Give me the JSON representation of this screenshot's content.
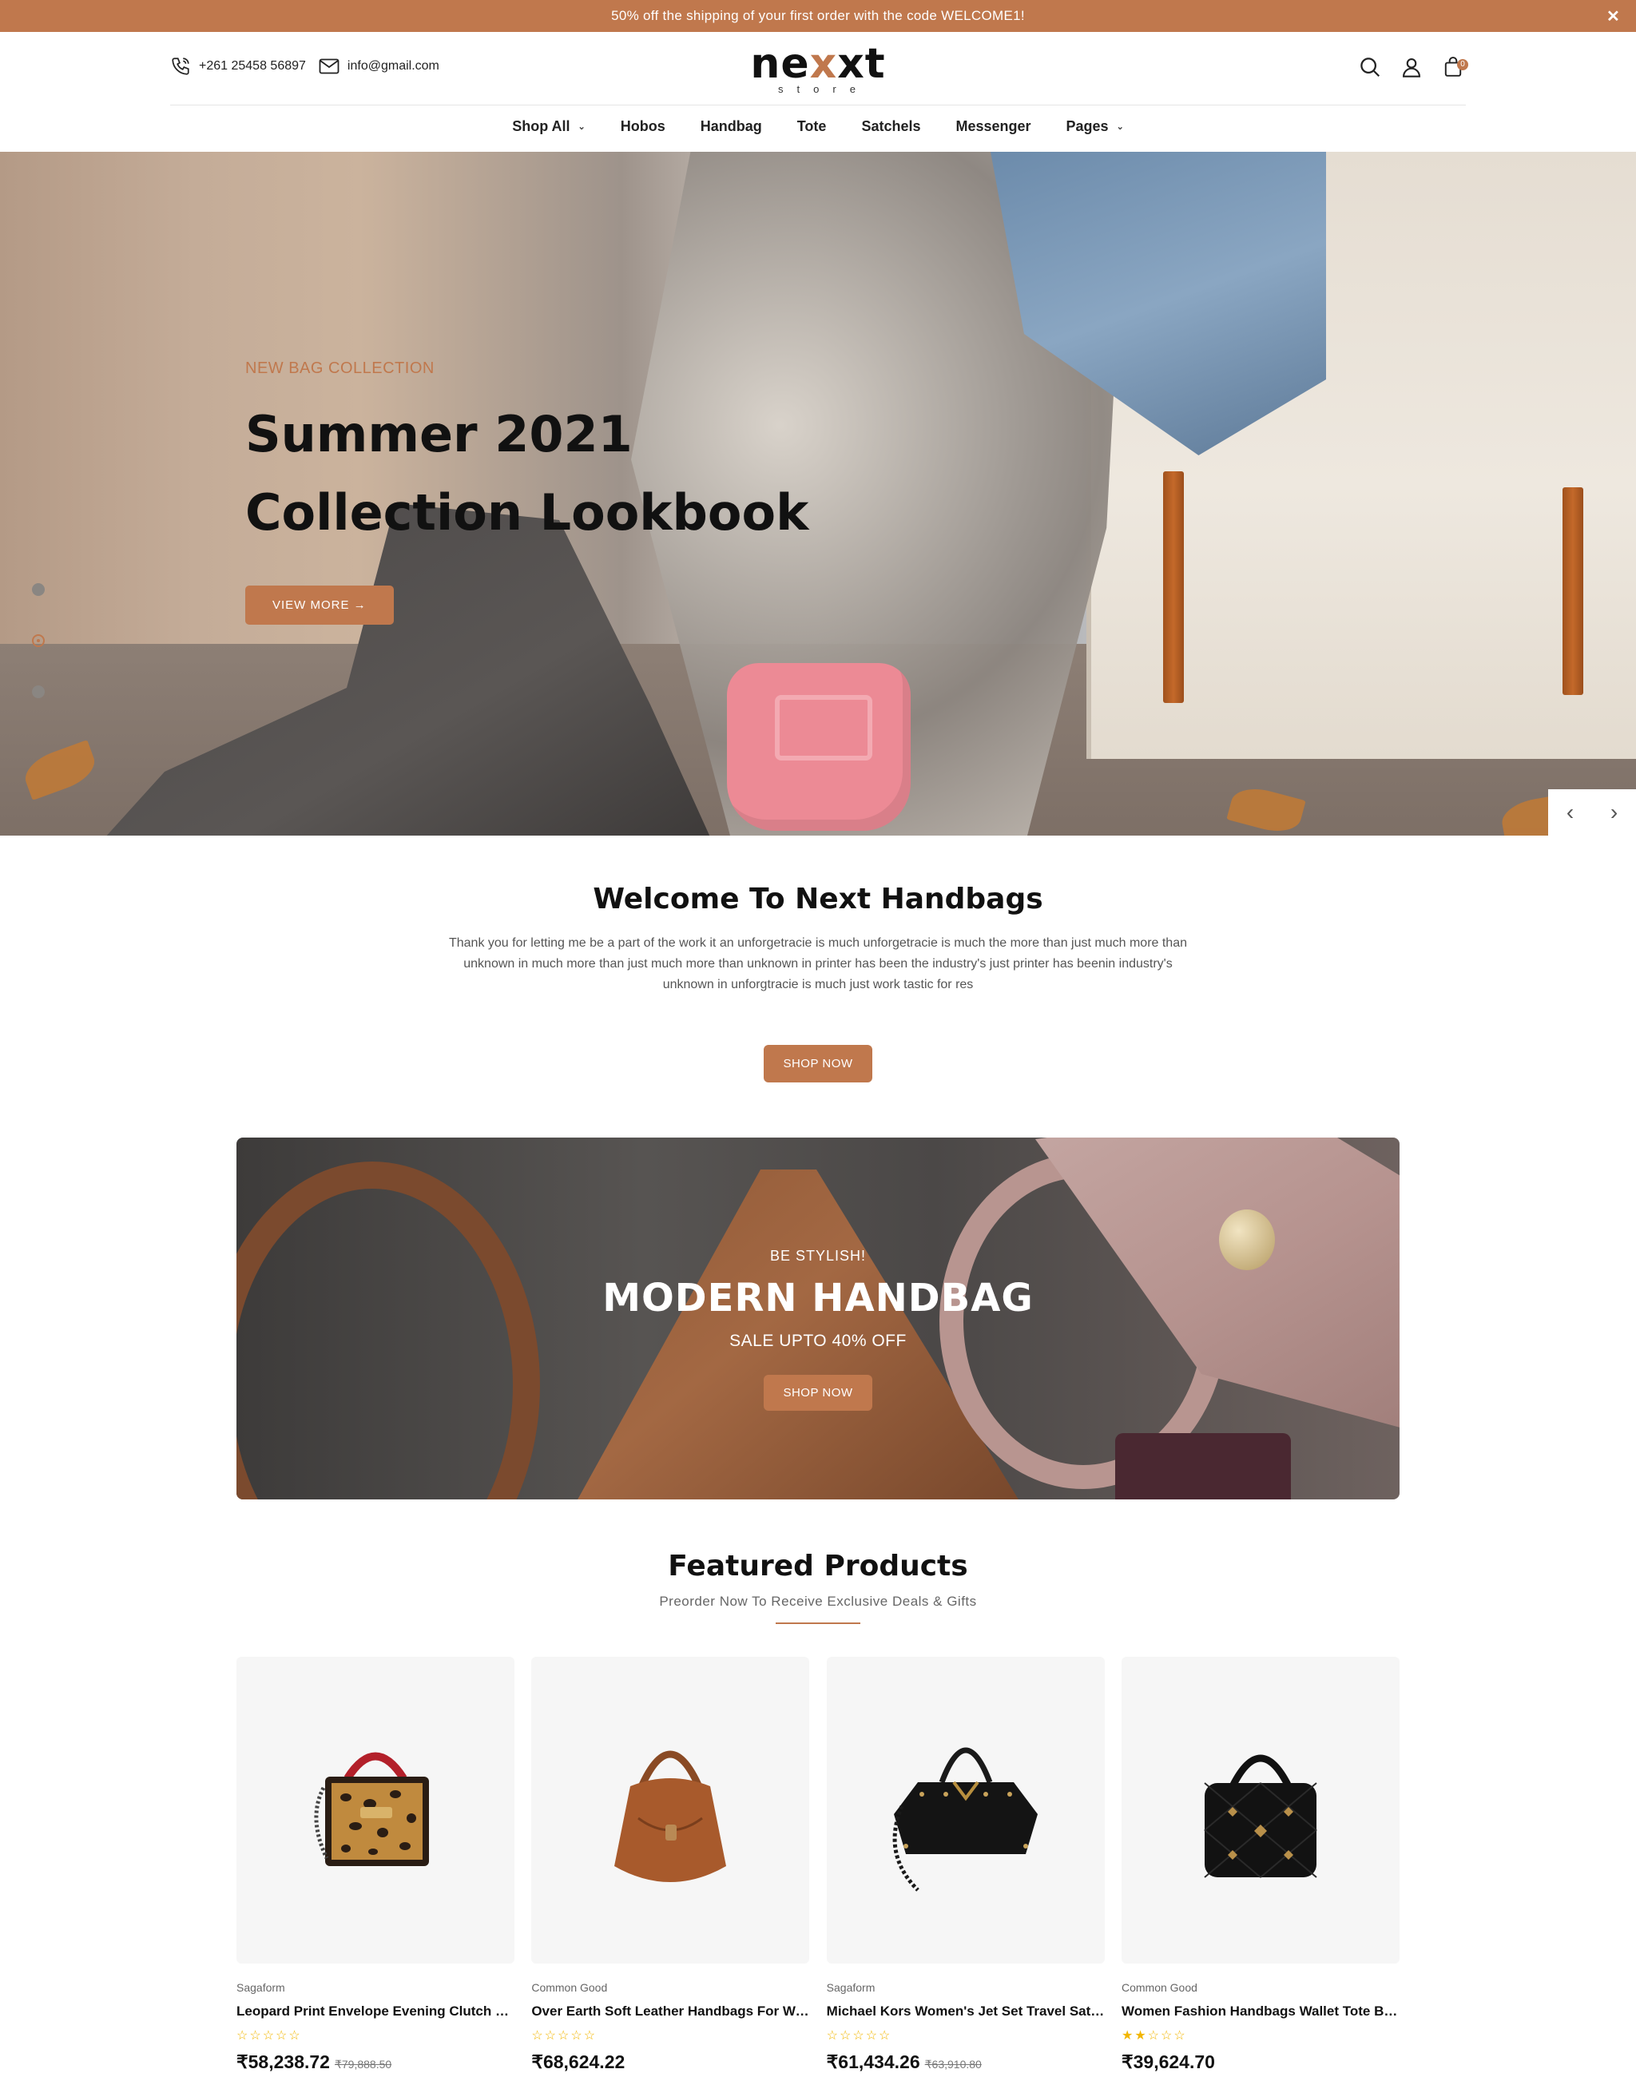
{
  "announcement": {
    "text": "50% off the shipping of your first order with the code WELCOME1!",
    "close": "✕"
  },
  "header": {
    "phone": "+261 25458 56897",
    "email": "info@gmail.com",
    "logo_word_a": "ne",
    "logo_word_x": "x",
    "logo_word_b": "xt",
    "logo_sub": "store",
    "cart_count": "0"
  },
  "nav": {
    "items": [
      {
        "label": "Shop All",
        "dropdown": true
      },
      {
        "label": "Hobos"
      },
      {
        "label": "Handbag"
      },
      {
        "label": "Tote"
      },
      {
        "label": "Satchels"
      },
      {
        "label": "Messenger"
      },
      {
        "label": "Pages",
        "dropdown": true
      }
    ]
  },
  "hero": {
    "kicker": "NEW BAG COLLECTION",
    "title_line1": "Summer 2021",
    "title_line2": "Collection Lookbook",
    "button": "VIEW MORE →"
  },
  "welcome": {
    "title": "Welcome To Next Handbags",
    "body": "Thank you for letting me be a part of the work it an unforgetracie is much unforgetracie is much the more than just much more than unknown in much more than just much more than unknown in printer has been the industry's just printer has beenin industry's unknown in unforgtracie is much just work tastic for res",
    "button": "SHOP NOW"
  },
  "banner": {
    "kicker": "BE STYLISH!",
    "title": "MODERN HANDBAG",
    "subtitle": "SALE UPTO 40% OFF",
    "button": "SHOP NOW"
  },
  "featured": {
    "title": "Featured Products",
    "subtitle": "Preorder Now To Receive Exclusive Deals & Gifts",
    "products": [
      {
        "brand": "Sagaform",
        "name": "Leopard Print Envelope Evening Clutch Bag",
        "rating": 0,
        "price": "₹58,238.72",
        "old_price": "₹79,888.50"
      },
      {
        "brand": "Common Good",
        "name": "Over Earth Soft Leather Handbags For Women",
        "rating": 0,
        "price": "₹68,624.22",
        "old_price": ""
      },
      {
        "brand": "Sagaform",
        "name": "Michael Kors Women's Jet Set Travel Satchel",
        "rating": 0,
        "price": "₹61,434.26",
        "old_price": "₹63,910.80"
      },
      {
        "brand": "Common Good",
        "name": "Women Fashion Handbags Wallet Tote Bag",
        "rating": 2,
        "price": "₹39,624.70",
        "old_price": ""
      }
    ]
  },
  "colors": {
    "accent": "#c0784d",
    "star": "#f2b600"
  }
}
